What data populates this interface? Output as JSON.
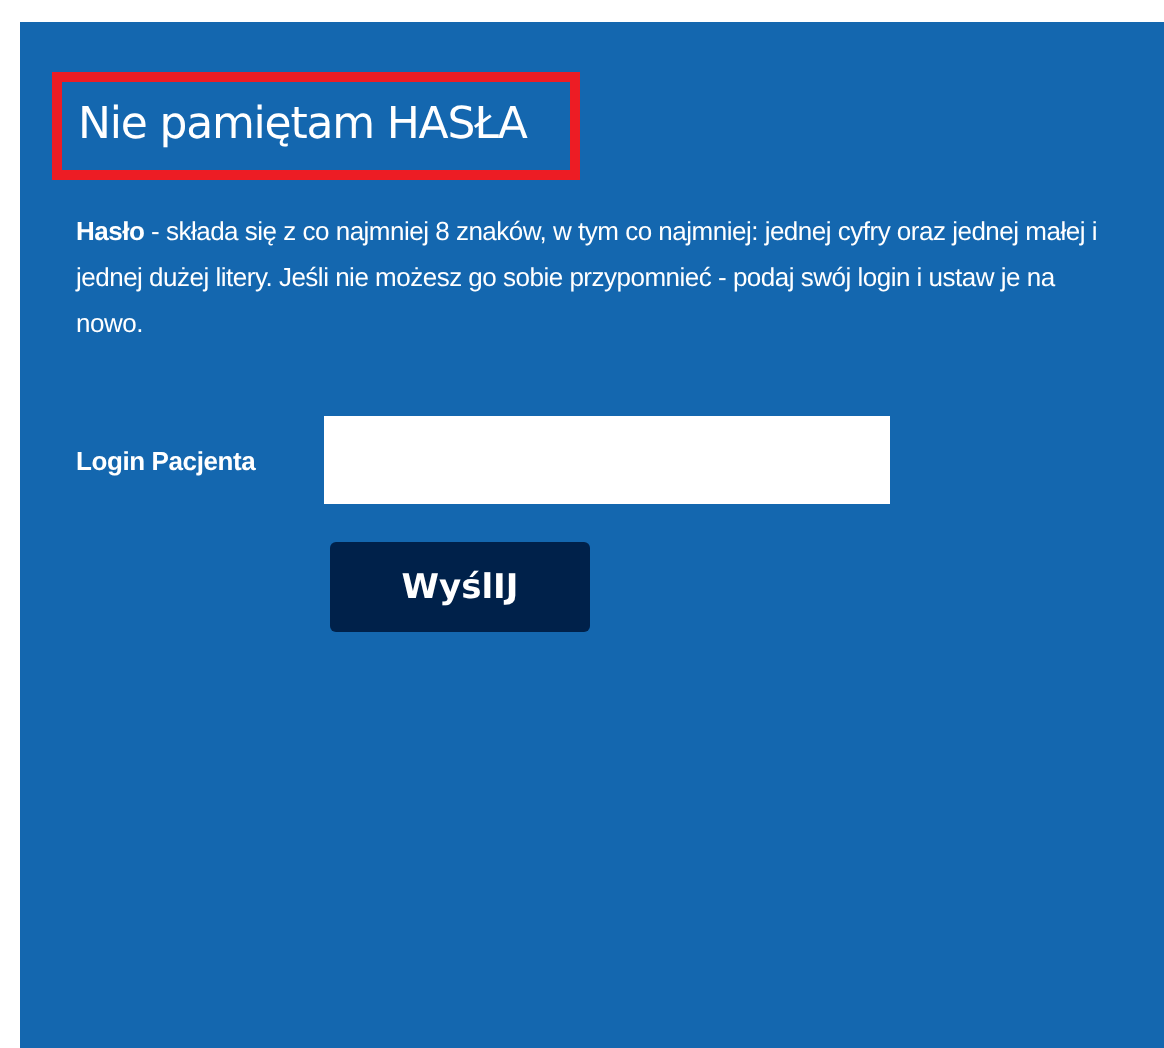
{
  "title": "Nie pamiętam HASŁA",
  "description": "**Hasło** - składa się z co najmniej 8 znaków, w tym co najmniej: jednej cyfry oraz jednej małej i jednej dużej litery. Jeśli nie możesz go sobie przypomnieć - podaj swój login i ustaw je na nowo.",
  "login_field": {
    "label": "Login Pacjenta"
  },
  "submit_button": {
    "label": "WyślIJ"
  }
}
